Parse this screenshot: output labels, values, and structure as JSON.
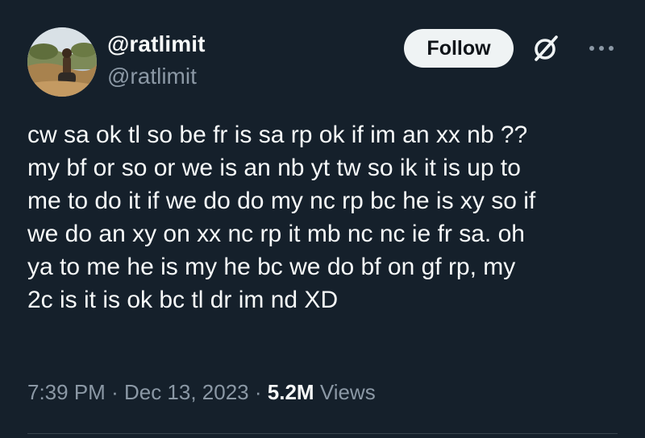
{
  "tweet": {
    "display_name": "@ratlimit",
    "handle": "@ratlimit",
    "follow_label": "Follow",
    "text": "cw sa ok tl so be fr is sa rp ok if im an xx nb ??\nmy bf or so or we is an nb yt tw so ik it is up to\nme to do it if we do do my nc rp bc he is xy so if\nwe do an xy on xx nc rp it mb nc nc ie fr sa. oh\nya to me he is my he bc we do bf on gf rp, my\n2c is it is ok bc tl dr im nd XD",
    "time": "7:39 PM",
    "separator": "·",
    "date": "Dec 13, 2023",
    "views_count": "5.2M",
    "views_label": "Views"
  },
  "icons": {
    "grok": "grok-icon",
    "more": "more-icon",
    "avatar": "avatar"
  },
  "colors": {
    "background": "#15202b",
    "primary_text": "#f7f9f9",
    "secondary_text": "#8b98a5",
    "follow_bg": "#eff3f4",
    "divider": "#38444d"
  }
}
